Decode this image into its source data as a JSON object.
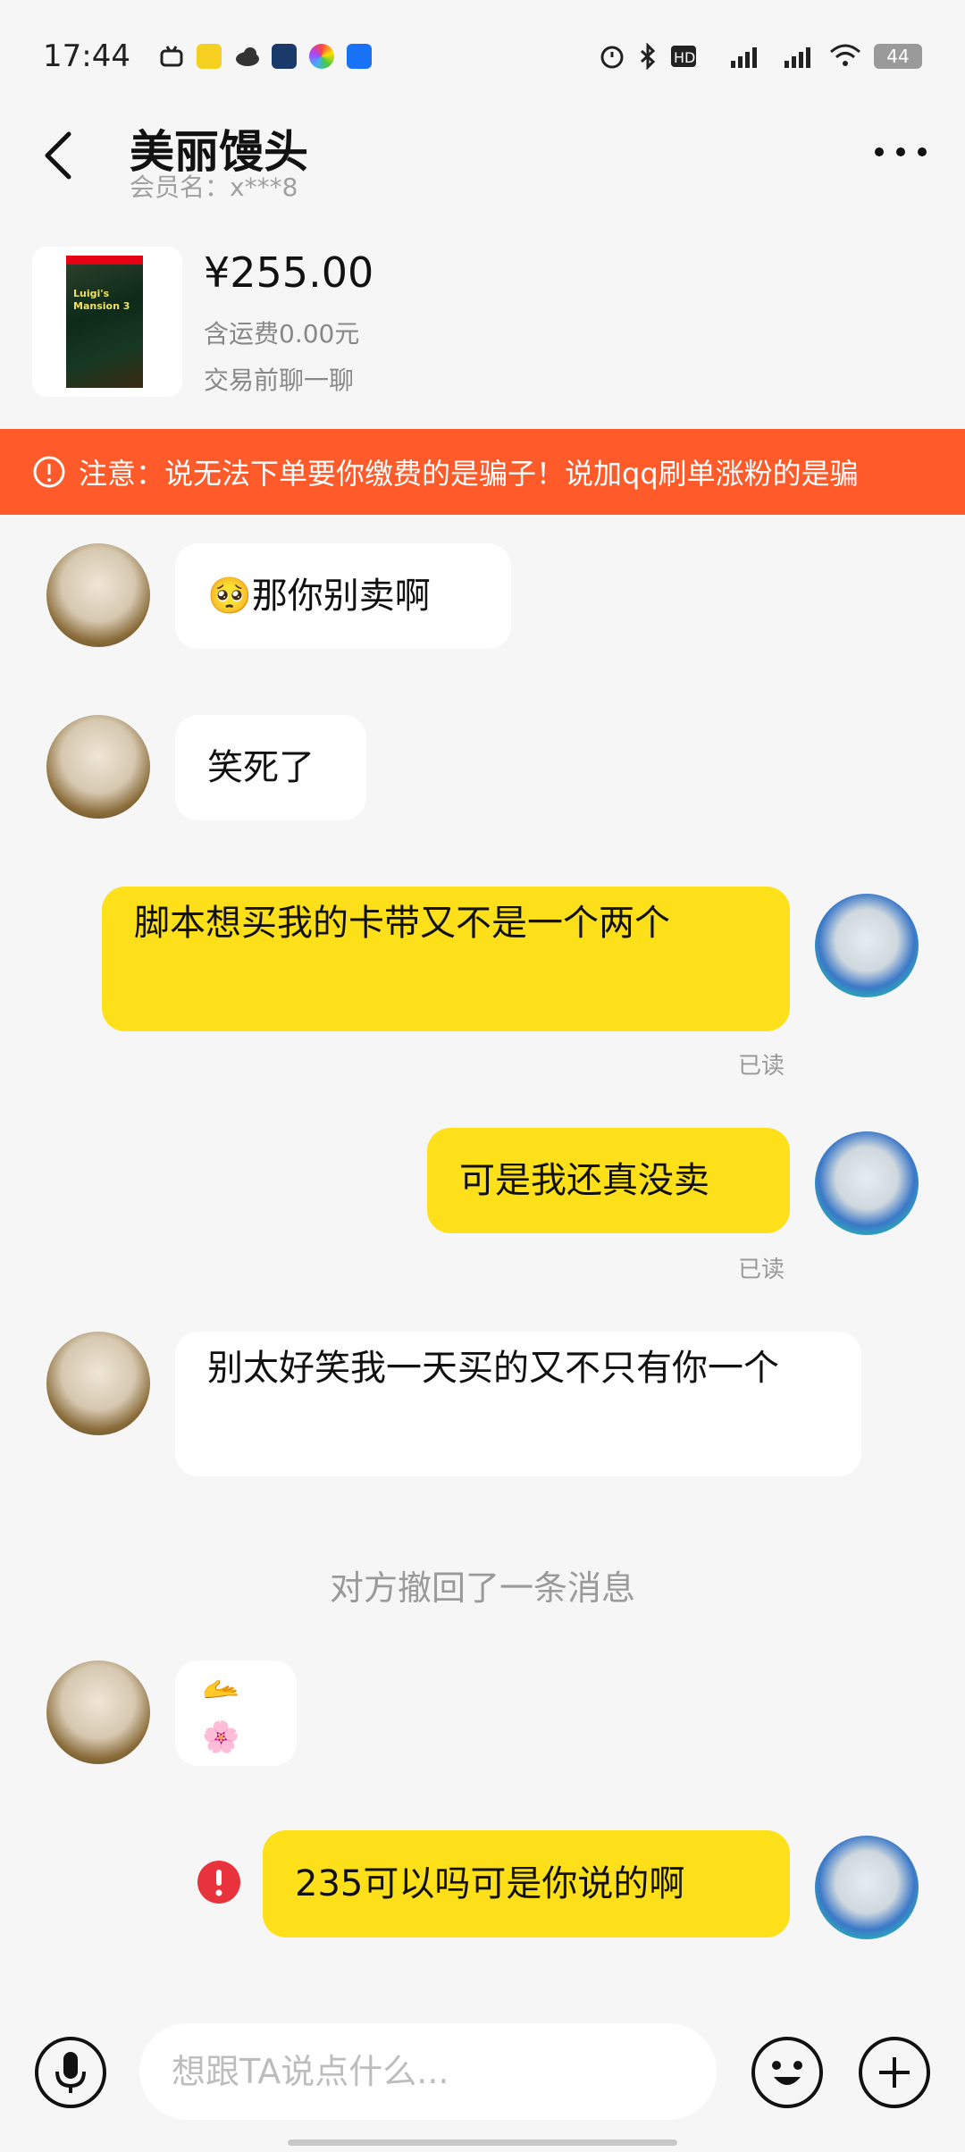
{
  "status_bar": {
    "time": "17:44",
    "battery": "44",
    "icons": [
      "bilibili-icon",
      "app-icon",
      "weather-icon",
      "game-icon",
      "photos-icon",
      "zhihu-icon",
      "alarm-icon",
      "bluetooth-icon",
      "hd-icon",
      "5g-signal-icon",
      "4g-signal-icon",
      "wifi-icon"
    ]
  },
  "header": {
    "title": "美丽馒头",
    "member": "会员名：x***8"
  },
  "product": {
    "price": "¥255.00",
    "shipping": "含运费0.00元",
    "chat_hint": "交易前聊一聊",
    "thumb_text": "Luigi's Mansion 3"
  },
  "warning": {
    "text": "注意：说无法下单要你缴费的是骗子！说加qq刷单涨粉的是骗"
  },
  "messages": [
    {
      "side": "in",
      "text": "那你别卖啊",
      "emoji": "🥺"
    },
    {
      "side": "in",
      "text": "笑死了"
    },
    {
      "side": "out",
      "text": "脚本想买我的卡带又不是一个两个",
      "status": "已读"
    },
    {
      "side": "out",
      "text": "可是我还真没卖",
      "status": "已读"
    },
    {
      "side": "in",
      "text": "别太好笑我一天买的又不只有你一个"
    },
    {
      "side": "system",
      "text": "对方撤回了一条消息"
    },
    {
      "side": "in",
      "text": "🫴🌸"
    },
    {
      "side": "out",
      "text": "235可以吗可是你说的啊",
      "status": "failed"
    }
  ],
  "input": {
    "placeholder": "想跟TA说点什么..."
  },
  "colors": {
    "warning_bg": "#ff5a2a",
    "outgoing_bubble": "#fde01a",
    "incoming_bubble": "#ffffff",
    "background": "#f6f6f6",
    "error": "#e8323c"
  }
}
